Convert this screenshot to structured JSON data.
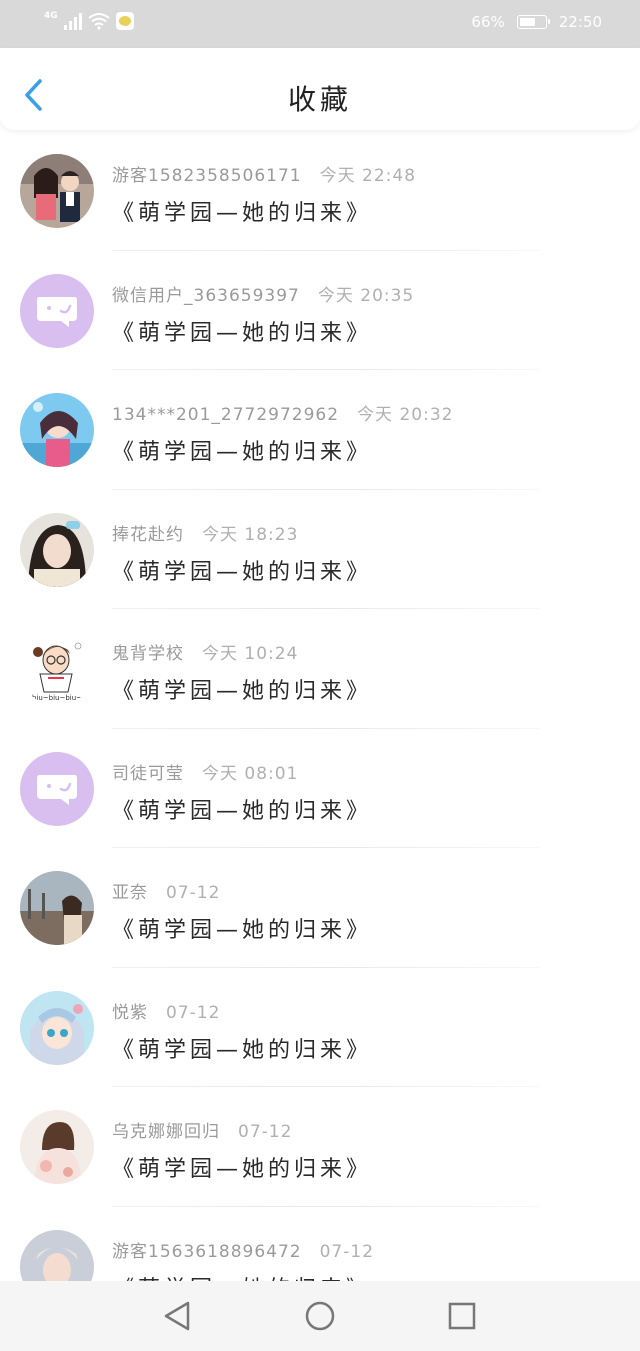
{
  "status_bar": {
    "network": "4G",
    "battery_text": "66%",
    "battery_level": 0.66,
    "time": "22:50"
  },
  "header": {
    "title": "收藏",
    "back_icon": "chevron-left-icon"
  },
  "colors": {
    "accent": "#3aa0e8",
    "chat_avatar_bg": "#d8bff0",
    "meta_text": "#9a9a9a"
  },
  "favorites": [
    {
      "user": "游客1582358506171",
      "time": "今天 22:48",
      "work": "《萌学园—她的归来》",
      "avatar": "photo-couple"
    },
    {
      "user": "微信用户_363659397",
      "time": "今天 20:35",
      "work": "《萌学园—她的归来》",
      "avatar": "chat-bubble-icon"
    },
    {
      "user": "134***201_2772972962",
      "time": "今天 20:32",
      "work": "《萌学园—她的归来》",
      "avatar": "photo-anime-girl"
    },
    {
      "user": "捧花赴约",
      "time": "今天 18:23",
      "work": "《萌学园—她的归来》",
      "avatar": "photo-girl-scarf"
    },
    {
      "user": "鬼背学校",
      "time": "今天 10:24",
      "work": "《萌学园—她的归来》",
      "avatar": "drawing-cartoon",
      "avatar_caption": "biu~biu~biu~"
    },
    {
      "user": "司徒可莹",
      "time": "今天 08:01",
      "work": "《萌学园—她的归来》",
      "avatar": "chat-bubble-icon"
    },
    {
      "user": "亚奈",
      "time": "07-12",
      "work": "《萌学园—她的归来》",
      "avatar": "photo-street"
    },
    {
      "user": "悦紫",
      "time": "07-12",
      "work": "《萌学园—她的归来》",
      "avatar": "photo-anime-blue"
    },
    {
      "user": "乌克娜娜回归",
      "time": "07-12",
      "work": "《萌学园—她的归来》",
      "avatar": "photo-girl-back"
    },
    {
      "user": "游客1563618896472",
      "time": "07-12",
      "work": "《萌学园—她的归来》",
      "avatar": "photo-boy"
    }
  ],
  "nav": {
    "back": "triangle-back-icon",
    "home": "circle-home-icon",
    "recents": "square-recents-icon"
  }
}
